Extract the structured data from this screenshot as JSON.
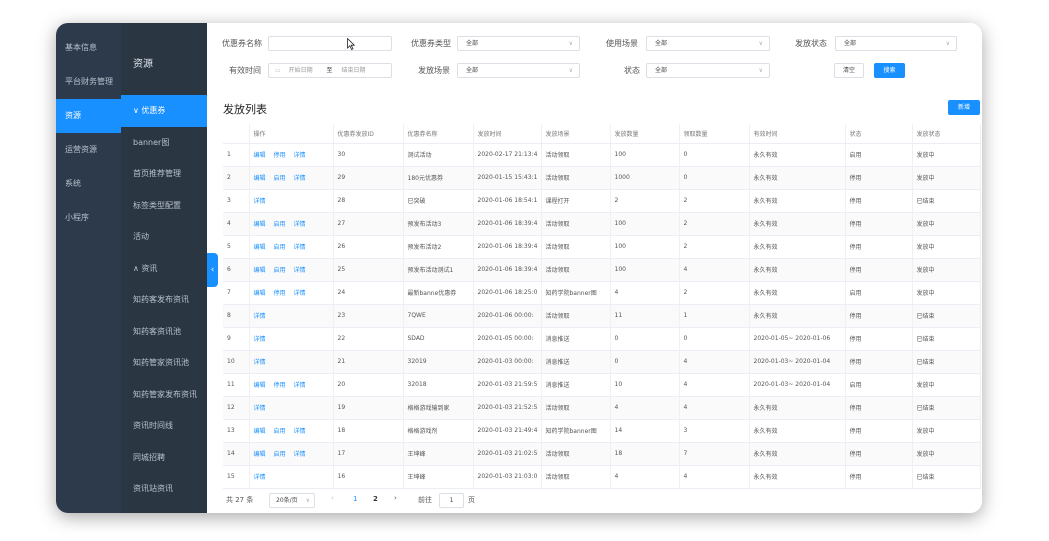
{
  "sidebar_primary": [
    {
      "label": "基本信息",
      "active": false
    },
    {
      "label": "平台财务管理",
      "active": false
    },
    {
      "label": "资源",
      "active": true
    },
    {
      "label": "运营资源",
      "active": false
    },
    {
      "label": "系统",
      "active": false
    },
    {
      "label": "小程序",
      "active": false
    }
  ],
  "sidebar_secondary": {
    "title": "资源",
    "items": [
      {
        "label": "∨ 优惠券",
        "active": true
      },
      {
        "label": "banner图",
        "active": false
      },
      {
        "label": "首页推荐管理",
        "active": false
      },
      {
        "label": "标签类型配置",
        "active": false
      },
      {
        "label": "活动",
        "active": false
      },
      {
        "label": "∧ 资讯",
        "active": false
      },
      {
        "label": "知药客发布资讯",
        "active": false
      },
      {
        "label": "知药客资讯池",
        "active": false
      },
      {
        "label": "知药管家资讯池",
        "active": false
      },
      {
        "label": "知药管家发布资讯",
        "active": false
      },
      {
        "label": "资讯时间线",
        "active": false
      },
      {
        "label": "同城招聘",
        "active": false
      },
      {
        "label": "资讯站资讯",
        "active": false
      }
    ]
  },
  "collapse_icon": "‹",
  "filters": {
    "coupon_name_label": "优惠券名称",
    "coupon_name_value": "",
    "coupon_type_label": "优惠券类型",
    "coupon_type_value": "全部",
    "use_scene_label": "使用场景",
    "use_scene_value": "全部",
    "issue_status_label": "发放状态",
    "issue_status_value": "全部",
    "valid_time_label": "有效时间",
    "start_date_placeholder": "开始日期",
    "date_separator": "至",
    "end_date_placeholder": "结束日期",
    "issue_scene_label": "发放场景",
    "issue_scene_value": "全部",
    "state_label": "状态",
    "state_value": "全部",
    "clear_label": "清空",
    "search_label": "搜索"
  },
  "list": {
    "title": "发放列表",
    "add_label": "新增"
  },
  "table": {
    "headers": [
      "",
      "操作",
      "优惠券发放ID",
      "优惠券名称",
      "发放时间",
      "发放场景",
      "发放数量",
      "领取数量",
      "有效时间",
      "状态",
      "发放状态"
    ],
    "rows": [
      {
        "no": "1",
        "ops": [
          "编辑",
          "停用",
          "详情"
        ],
        "id": "30",
        "name": "测试活动",
        "time": "2020-02-17 21:13:4",
        "scene": "活动领取",
        "qty": "100",
        "recv": "0",
        "valid": "永久有效",
        "state": "启用",
        "status": "发放中"
      },
      {
        "no": "2",
        "ops": [
          "编辑",
          "启用",
          "详情"
        ],
        "id": "29",
        "name": "180元优惠券",
        "time": "2020-01-15 15:43:1",
        "scene": "活动领取",
        "qty": "1000",
        "recv": "0",
        "valid": "永久有效",
        "state": "停用",
        "status": "发放中"
      },
      {
        "no": "3",
        "ops": [
          "详情"
        ],
        "id": "28",
        "name": "已突破",
        "time": "2020-01-06 18:54:1",
        "scene": "课程打开",
        "qty": "2",
        "recv": "2",
        "valid": "永久有效",
        "state": "停用",
        "status": "已结束"
      },
      {
        "no": "4",
        "ops": [
          "编辑",
          "启用",
          "详情"
        ],
        "id": "27",
        "name": "预发布活动3",
        "time": "2020-01-06 18:39:4",
        "scene": "活动领取",
        "qty": "100",
        "recv": "2",
        "valid": "永久有效",
        "state": "停用",
        "status": "发放中"
      },
      {
        "no": "5",
        "ops": [
          "编辑",
          "启用",
          "详情"
        ],
        "id": "26",
        "name": "预发布活动2",
        "time": "2020-01-06 18:39:4",
        "scene": "活动领取",
        "qty": "100",
        "recv": "2",
        "valid": "永久有效",
        "state": "停用",
        "status": "发放中"
      },
      {
        "no": "6",
        "ops": [
          "编辑",
          "启用",
          "详情"
        ],
        "id": "25",
        "name": "预发布活动测试1",
        "time": "2020-01-06 18:39:4",
        "scene": "活动领取",
        "qty": "100",
        "recv": "4",
        "valid": "永久有效",
        "state": "停用",
        "status": "发放中"
      },
      {
        "no": "7",
        "ops": [
          "编辑",
          "停用",
          "详情"
        ],
        "id": "24",
        "name": "最新banne优惠券",
        "time": "2020-01-06 18:25:0",
        "scene": "知药学院banner图",
        "qty": "4",
        "recv": "2",
        "valid": "永久有效",
        "state": "启用",
        "status": "发放中"
      },
      {
        "no": "8",
        "ops": [
          "详情"
        ],
        "id": "23",
        "name": "7QWE",
        "time": "2020-01-06 00:00:",
        "scene": "活动领取",
        "qty": "11",
        "recv": "1",
        "valid": "永久有效",
        "state": "停用",
        "status": "已结束"
      },
      {
        "no": "9",
        "ops": [
          "详情"
        ],
        "id": "22",
        "name": "SDAD",
        "time": "2020-01-05 00:00:",
        "scene": "消息推送",
        "qty": "0",
        "recv": "0",
        "valid": "2020-01-05~ 2020-01-06",
        "state": "停用",
        "status": "已结束"
      },
      {
        "no": "10",
        "ops": [
          "详情"
        ],
        "id": "21",
        "name": "32019",
        "time": "2020-01-03 00:00:",
        "scene": "消息推送",
        "qty": "0",
        "recv": "4",
        "valid": "2020-01-03~ 2020-01-04",
        "state": "停用",
        "status": "已结束"
      },
      {
        "no": "11",
        "ops": [
          "编辑",
          "停用",
          "详情"
        ],
        "id": "20",
        "name": "32018",
        "time": "2020-01-03 21:59:5",
        "scene": "消息推送",
        "qty": "10",
        "recv": "4",
        "valid": "2020-01-03~ 2020-01-04",
        "state": "启用",
        "status": "发放中"
      },
      {
        "no": "12",
        "ops": [
          "详情"
        ],
        "id": "19",
        "name": "格格游戏输到家",
        "time": "2020-01-03 21:52:5",
        "scene": "活动领取",
        "qty": "4",
        "recv": "4",
        "valid": "永久有效",
        "state": "停用",
        "status": "已结束"
      },
      {
        "no": "13",
        "ops": [
          "编辑",
          "启用",
          "详情"
        ],
        "id": "18",
        "name": "格格游戏剂",
        "time": "2020-01-03 21:49:4",
        "scene": "知药学院banner图",
        "qty": "14",
        "recv": "3",
        "valid": "永久有效",
        "state": "停用",
        "status": "发放中"
      },
      {
        "no": "14",
        "ops": [
          "编辑",
          "启用",
          "详情"
        ],
        "id": "17",
        "name": "王坤峰",
        "time": "2020-01-03 21:02:5",
        "scene": "活动领取",
        "qty": "18",
        "recv": "7",
        "valid": "永久有效",
        "state": "停用",
        "status": "发放中"
      },
      {
        "no": "15",
        "ops": [
          "详情"
        ],
        "id": "16",
        "name": "王坤峰",
        "time": "2020-01-03 21:03:0",
        "scene": "活动领取",
        "qty": "4",
        "recv": "4",
        "valid": "永久有效",
        "state": "停用",
        "status": "已结束"
      }
    ]
  },
  "pagination": {
    "total": "共 27 条",
    "page_size": "20条/页",
    "prev": "‹",
    "pages": [
      "1",
      "2"
    ],
    "next": "›",
    "goto_label": "前往",
    "goto_value": "1",
    "page_suffix": "页"
  },
  "colors": {
    "accent": "#1890ff",
    "sidebar_primary_bg": "#2d3a4b",
    "sidebar_secondary_bg": "#2b3643"
  }
}
